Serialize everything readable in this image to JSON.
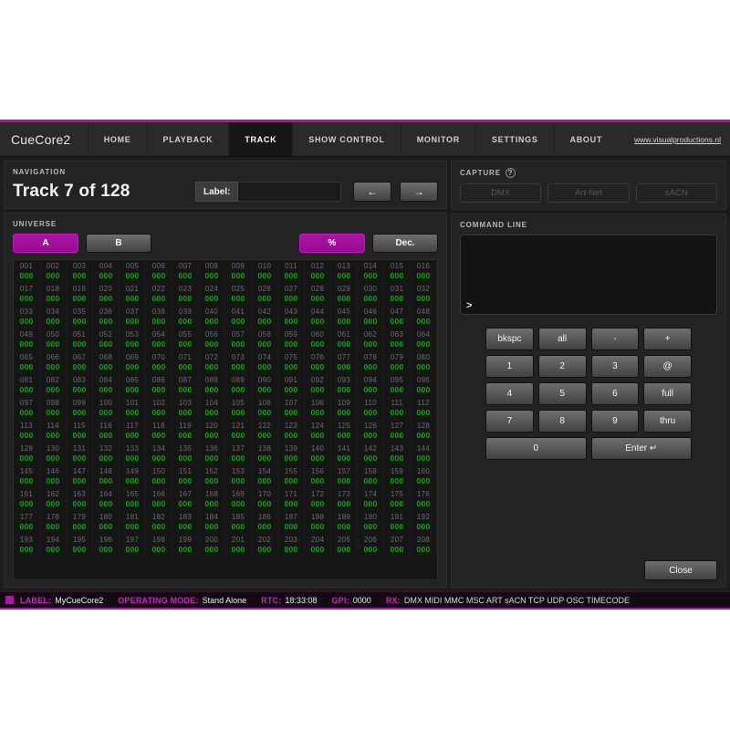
{
  "app": {
    "brand": "CueCore2",
    "weblink": "www.visualproductions.nl",
    "accent": "#b313ad",
    "value_color": "#14a314"
  },
  "nav_tabs": [
    {
      "label": "HOME",
      "active": false
    },
    {
      "label": "PLAYBACK",
      "active": false
    },
    {
      "label": "TRACK",
      "active": true
    },
    {
      "label": "SHOW CONTROL",
      "active": false
    },
    {
      "label": "MONITOR",
      "active": false
    },
    {
      "label": "SETTINGS",
      "active": false
    },
    {
      "label": "ABOUT",
      "active": false
    }
  ],
  "navigation": {
    "title": "NAVIGATION",
    "track_title": "Track 7 of 128",
    "label_tag": "Label:",
    "label_value": "",
    "label_placeholder": "",
    "prev_arrow": "←",
    "next_arrow": "→"
  },
  "universe": {
    "title": "UNIVERSE",
    "buttons": [
      {
        "label": "A",
        "active": true
      },
      {
        "label": "B",
        "active": false
      }
    ],
    "format_buttons": [
      {
        "label": "%",
        "active": true
      },
      {
        "label": "Dec.",
        "active": false
      }
    ],
    "columns": 16,
    "first_channel": 1,
    "last_channel": 208,
    "default_value": "000"
  },
  "capture": {
    "title": "CAPTURE",
    "help_icon": "question-mark-icon",
    "help_glyph": "?",
    "buttons": [
      "DMX",
      "Art-Net",
      "sACN"
    ]
  },
  "command_line": {
    "title": "COMMAND LINE",
    "prompt": ">",
    "text": "",
    "keys": [
      {
        "label": "bkspc",
        "wide": false
      },
      {
        "label": "all",
        "wide": false
      },
      {
        "label": "-",
        "wide": false
      },
      {
        "label": "+",
        "wide": false
      },
      {
        "label": "1",
        "wide": false
      },
      {
        "label": "2",
        "wide": false
      },
      {
        "label": "3",
        "wide": false
      },
      {
        "label": "@",
        "wide": false
      },
      {
        "label": "4",
        "wide": false
      },
      {
        "label": "5",
        "wide": false
      },
      {
        "label": "6",
        "wide": false
      },
      {
        "label": "full",
        "wide": false
      },
      {
        "label": "7",
        "wide": false
      },
      {
        "label": "8",
        "wide": false
      },
      {
        "label": "9",
        "wide": false
      },
      {
        "label": "thru",
        "wide": false
      },
      {
        "label": "0",
        "wide": true
      },
      {
        "label": "Enter ↵",
        "wide": true
      }
    ],
    "close_label": "Close"
  },
  "statusbar": {
    "label_key": "LABEL:",
    "label_value": "MyCueCore2",
    "mode_key": "OPERATING MODE:",
    "mode_value": "Stand Alone",
    "rtc_key": "RTC:",
    "rtc_value": "18:33:08",
    "gpi_key": "GPI:",
    "gpi_value": "0000",
    "rx_key": "RX:",
    "rx_value": "DMX MIDI MMC MSC ART sACN TCP UDP OSC TIMECODE"
  }
}
